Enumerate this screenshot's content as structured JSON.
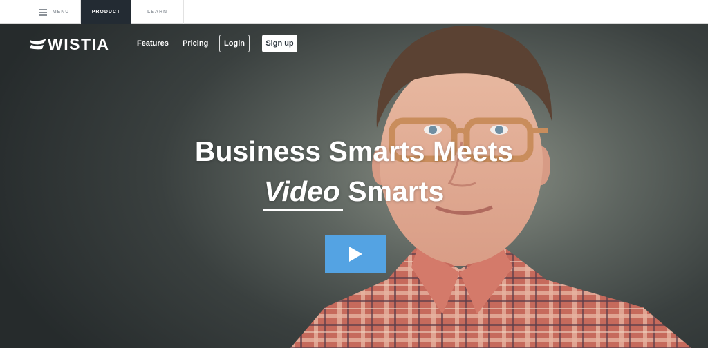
{
  "topbar": {
    "tabs": [
      {
        "label": "MENU",
        "icon": "hamburger-icon"
      },
      {
        "label": "PRODUCT",
        "active": true
      },
      {
        "label": "LEARN"
      }
    ]
  },
  "header": {
    "logo_text": "WISTIA",
    "nav": {
      "features": "Features",
      "pricing": "Pricing",
      "login": "Login",
      "signup": "Sign up"
    }
  },
  "hero": {
    "line1": "Business Smarts Meets",
    "line2_emphasis": "Video",
    "line2_rest": " Smarts",
    "play_icon": "play-icon",
    "colors": {
      "play_button": "#54a3e3",
      "active_tab": "#232b33",
      "background": "#3a403f"
    }
  }
}
